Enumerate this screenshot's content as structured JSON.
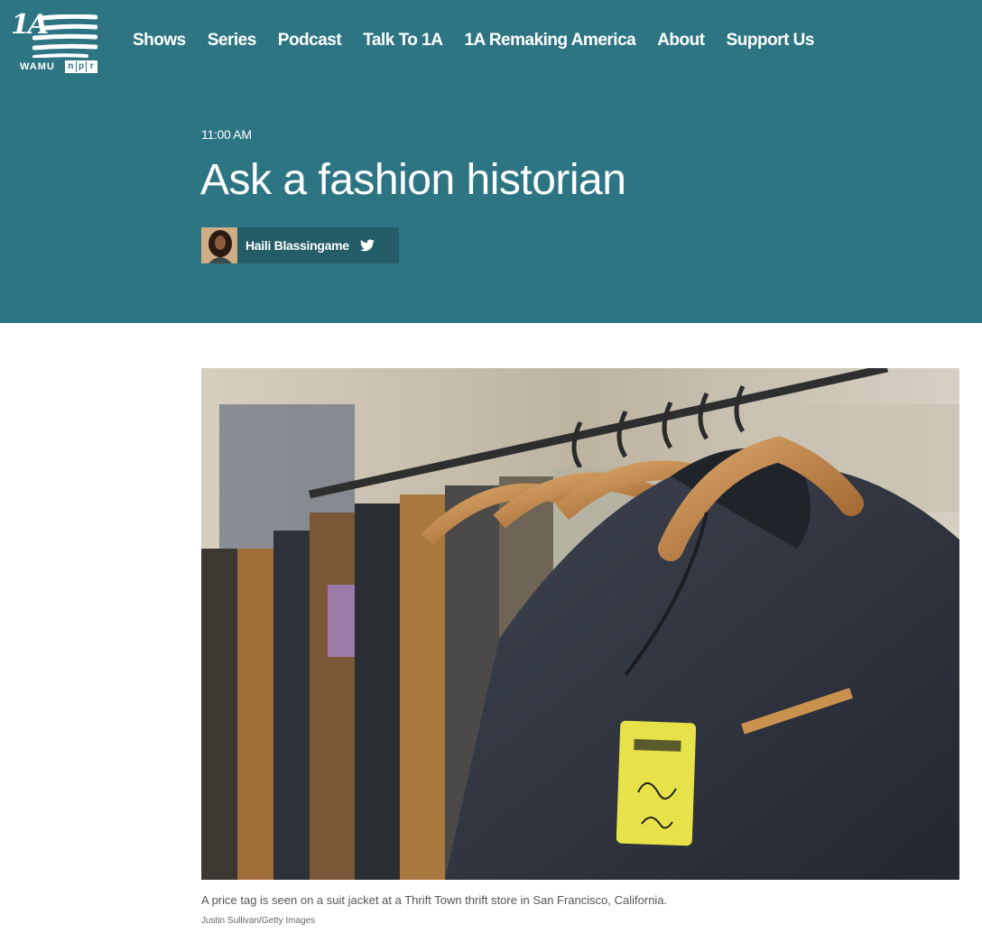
{
  "brand": {
    "wordmark": "1A",
    "station": "WAMU",
    "network": [
      "n",
      "p",
      "r"
    ]
  },
  "nav": {
    "items": [
      "Shows",
      "Series",
      "Podcast",
      "Talk To 1A",
      "1A Remaking America",
      "About",
      "Support Us"
    ]
  },
  "article": {
    "time": "11:00 AM",
    "title": "Ask a fashion historian",
    "author": "Haili Blassingame",
    "author_icon": "twitter-icon"
  },
  "photo": {
    "caption": "A price tag is seen on a suit jacket at a Thrift Town thrift store in San Francisco, California.",
    "credit": "Justin Sullivan/Getty Images"
  },
  "colors": {
    "header_bg": "#2e7584",
    "author_chip_bg": "#245c68",
    "text_light": "#ffffff"
  }
}
